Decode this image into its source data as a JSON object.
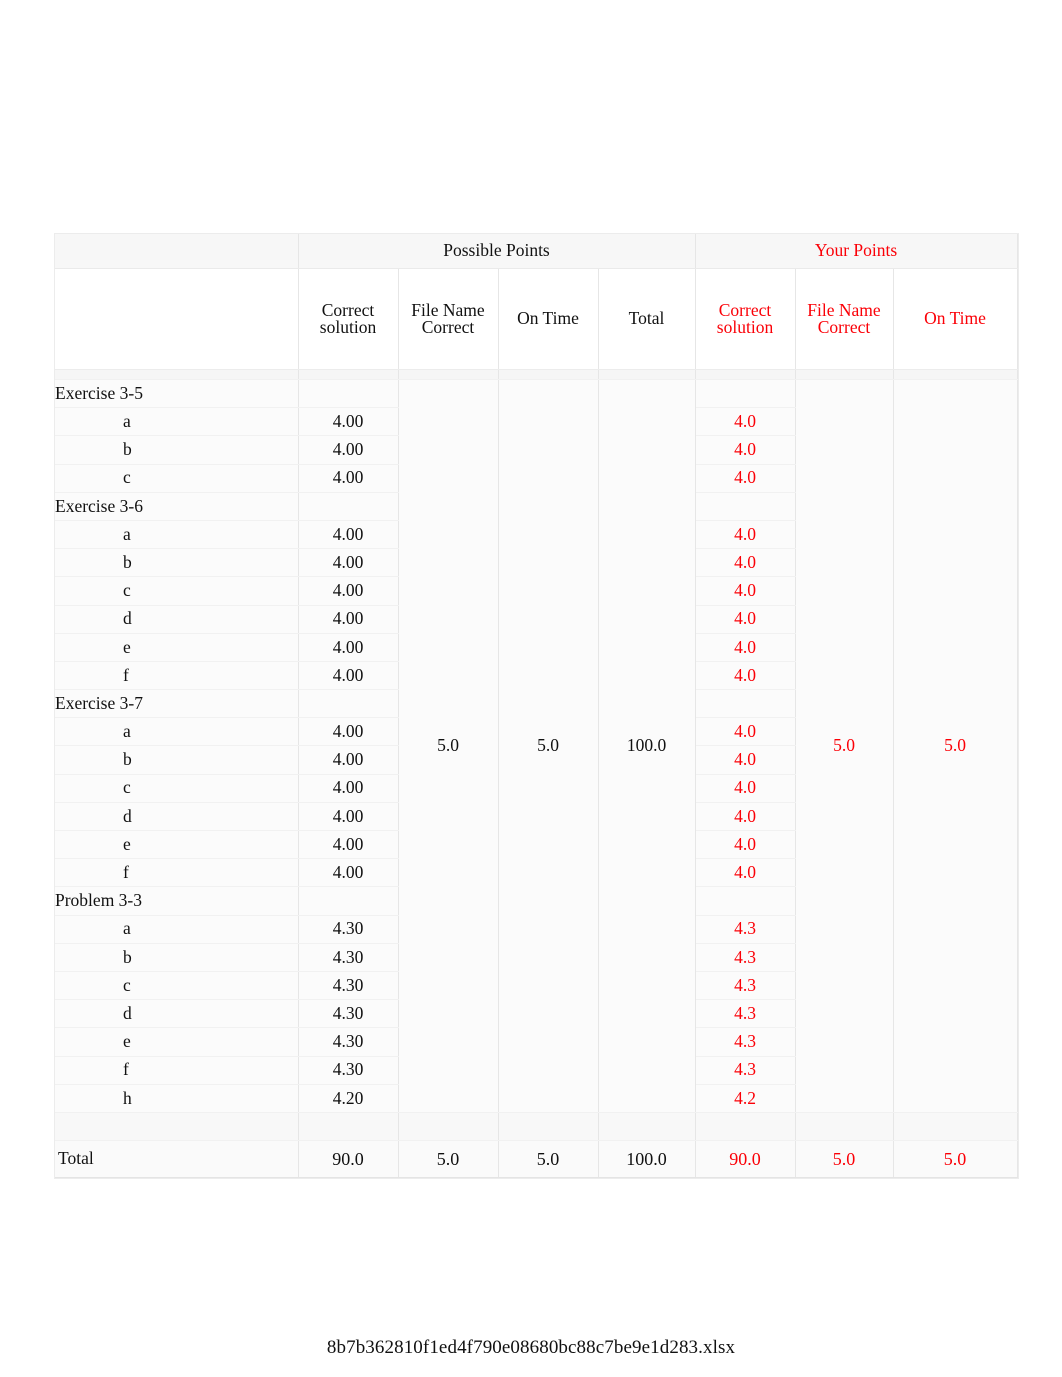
{
  "document": {
    "footer_filename": "8b7b362810f1ed4f790e08680bc88c7be9e1d283.xlsx"
  },
  "colors": {
    "your_points_red": "#FB0007",
    "text_black": "#111111",
    "grid_line": "#E6E6E6",
    "page_background": "#FFFFFF"
  },
  "table": {
    "group_headers": {
      "row_label_blank": "",
      "possible_points": "Possible Points",
      "your_points": "Your Points"
    },
    "column_headers": {
      "row_label_blank": "",
      "possible_correct_solution": "Correct solution",
      "possible_file_name_correct": "File Name Correct",
      "possible_on_time": "On Time",
      "possible_total": "Total",
      "your_correct_solution": "Correct solution",
      "your_file_name_correct": "File Name Correct",
      "your_on_time": "On Time"
    },
    "merged_possible": {
      "file_name_correct": "5.0",
      "on_time": "5.0",
      "total": "100.0"
    },
    "merged_your": {
      "file_name_correct": "5.0",
      "on_time": "5.0"
    },
    "rows": [
      {
        "type": "group",
        "label": "Exercise 3-5",
        "possible": "",
        "your": ""
      },
      {
        "type": "item",
        "label": "a",
        "possible": "4.00",
        "your": "4.0"
      },
      {
        "type": "item",
        "label": "b",
        "possible": "4.00",
        "your": "4.0"
      },
      {
        "type": "item",
        "label": "c",
        "possible": "4.00",
        "your": "4.0"
      },
      {
        "type": "group",
        "label": "Exercise 3-6",
        "possible": "",
        "your": ""
      },
      {
        "type": "item",
        "label": "a",
        "possible": "4.00",
        "your": "4.0"
      },
      {
        "type": "item",
        "label": "b",
        "possible": "4.00",
        "your": "4.0"
      },
      {
        "type": "item",
        "label": "c",
        "possible": "4.00",
        "your": "4.0"
      },
      {
        "type": "item",
        "label": "d",
        "possible": "4.00",
        "your": "4.0"
      },
      {
        "type": "item",
        "label": "e",
        "possible": "4.00",
        "your": "4.0"
      },
      {
        "type": "item",
        "label": "f",
        "possible": "4.00",
        "your": "4.0"
      },
      {
        "type": "group",
        "label": "Exercise 3-7",
        "possible": "",
        "your": ""
      },
      {
        "type": "item",
        "label": "a",
        "possible": "4.00",
        "your": "4.0"
      },
      {
        "type": "item",
        "label": "b",
        "possible": "4.00",
        "your": "4.0"
      },
      {
        "type": "item",
        "label": "c",
        "possible": "4.00",
        "your": "4.0"
      },
      {
        "type": "item",
        "label": "d",
        "possible": "4.00",
        "your": "4.0"
      },
      {
        "type": "item",
        "label": "e",
        "possible": "4.00",
        "your": "4.0"
      },
      {
        "type": "item",
        "label": "f",
        "possible": "4.00",
        "your": "4.0"
      },
      {
        "type": "group",
        "label": "Problem 3-3",
        "possible": "",
        "your": ""
      },
      {
        "type": "item",
        "label": "a",
        "possible": "4.30",
        "your": "4.3"
      },
      {
        "type": "item",
        "label": "b",
        "possible": "4.30",
        "your": "4.3"
      },
      {
        "type": "item",
        "label": "c",
        "possible": "4.30",
        "your": "4.3"
      },
      {
        "type": "item",
        "label": "d",
        "possible": "4.30",
        "your": "4.3"
      },
      {
        "type": "item",
        "label": "e",
        "possible": "4.30",
        "your": "4.3"
      },
      {
        "type": "item",
        "label": "f",
        "possible": "4.30",
        "your": "4.3"
      },
      {
        "type": "item",
        "label": "h",
        "possible": "4.20",
        "your": "4.2"
      }
    ],
    "total_row": {
      "label": "Total",
      "possible_correct_solution": "90.0",
      "possible_file_name_correct": "5.0",
      "possible_on_time": "5.0",
      "possible_total": "100.0",
      "your_correct_solution": "90.0",
      "your_file_name_correct": "5.0",
      "your_on_time": "5.0"
    }
  }
}
